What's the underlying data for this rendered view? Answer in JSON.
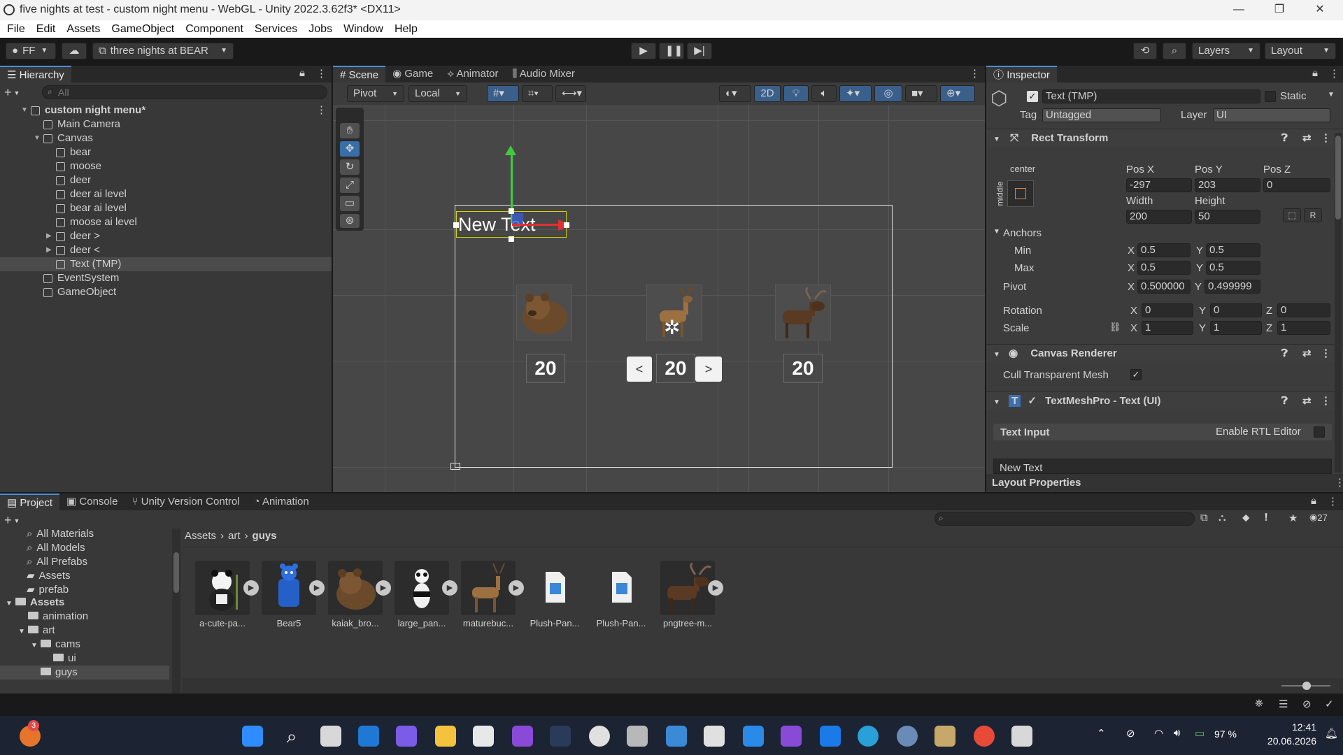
{
  "window": {
    "title": "five nights at test - custom night menu - WebGL - Unity 2022.3.62f3* <DX11>",
    "minimize": "—",
    "restore": "❐",
    "close": "✕"
  },
  "menu": [
    "File",
    "Edit",
    "Assets",
    "GameObject",
    "Component",
    "Services",
    "Jobs",
    "Window",
    "Help"
  ],
  "toolbar": {
    "account": "FF",
    "project": "three nights at BEAR",
    "layers": "Layers",
    "layout": "Layout"
  },
  "hierarchy": {
    "tab": "Hierarchy",
    "search_placeholder": "All",
    "items": [
      {
        "label": "custom night menu*",
        "indent": 0,
        "scene": true
      },
      {
        "label": "Main Camera",
        "indent": 1
      },
      {
        "label": "Canvas",
        "indent": 1,
        "expanded": true
      },
      {
        "label": "bear",
        "indent": 2
      },
      {
        "label": "moose",
        "indent": 2
      },
      {
        "label": "deer",
        "indent": 2
      },
      {
        "label": "deer ai level",
        "indent": 2
      },
      {
        "label": "bear ai level",
        "indent": 2
      },
      {
        "label": "moose ai level",
        "indent": 2
      },
      {
        "label": "deer >",
        "indent": 2,
        "collapsed": true
      },
      {
        "label": "deer <",
        "indent": 2,
        "collapsed": true
      },
      {
        "label": "Text (TMP)",
        "indent": 2,
        "selected": true
      },
      {
        "label": "EventSystem",
        "indent": 1
      },
      {
        "label": "GameObject",
        "indent": 1
      }
    ]
  },
  "scene_tabs": [
    "Scene",
    "Game",
    "Animator",
    "Audio Mixer"
  ],
  "scene_toolbar": {
    "pivot": "Pivot",
    "local": "Local",
    "mode2d": "2D"
  },
  "scene": {
    "text_object": "New Text",
    "levels": [
      "20",
      "20",
      "20"
    ],
    "left_button": "<",
    "right_button": ">"
  },
  "inspector": {
    "tab": "Inspector",
    "object_name": "Text (TMP)",
    "static": "Static",
    "tag_label": "Tag",
    "tag": "Untagged",
    "layer_label": "Layer",
    "layer": "UI",
    "rect_transform": {
      "title": "Rect Transform",
      "anchor_h": "center",
      "anchor_v": "middle",
      "posx_label": "Pos X",
      "posx": "-297",
      "posy_label": "Pos Y",
      "posy": "203",
      "posz_label": "Pos Z",
      "posz": "0",
      "width_label": "Width",
      "width": "200",
      "height_label": "Height",
      "height": "50",
      "anchors": "Anchors",
      "min": "Min",
      "min_x": "0.5",
      "min_y": "0.5",
      "max": "Max",
      "max_x": "0.5",
      "max_y": "0.5",
      "pivot": "Pivot",
      "pivot_x": "0.500000",
      "pivot_y": "0.499999",
      "rotation": "Rotation",
      "rot_x": "0",
      "rot_y": "0",
      "rot_z": "0",
      "scale": "Scale",
      "scale_x": "1",
      "scale_y": "1",
      "scale_z": "1"
    },
    "canvas_renderer": {
      "title": "Canvas Renderer",
      "cull": "Cull Transparent Mesh"
    },
    "tmp": {
      "title": "TextMeshPro - Text (UI)",
      "text_input": "Text Input",
      "rtl": "Enable RTL Editor",
      "value": "New Text"
    },
    "layout_properties": "Layout Properties"
  },
  "project": {
    "tabs": [
      "Project",
      "Console",
      "Unity Version Control",
      "Animation"
    ],
    "count": "27",
    "favorites": [
      "All Materials",
      "All Models",
      "All Prefabs",
      "Assets",
      "prefab"
    ],
    "tree": [
      {
        "label": "Assets",
        "indent": 0,
        "bold": true
      },
      {
        "label": "animation",
        "indent": 1
      },
      {
        "label": "art",
        "indent": 1
      },
      {
        "label": "cams",
        "indent": 2
      },
      {
        "label": "ui",
        "indent": 3
      },
      {
        "label": "guys",
        "indent": 2,
        "selected": true
      }
    ],
    "breadcrumb": [
      "Assets",
      "art",
      "guys"
    ],
    "assets": [
      "a-cute-pa...",
      "Bear5",
      "kaiak_bro...",
      "large_pan...",
      "maturebuc...",
      "Plush-Pan...",
      "Plush-Pan...",
      "pngtree-m..."
    ]
  },
  "taskbar": {
    "battery": "97 %",
    "time": "12:41",
    "date": "20.06.2026",
    "notification_badge": "3"
  }
}
